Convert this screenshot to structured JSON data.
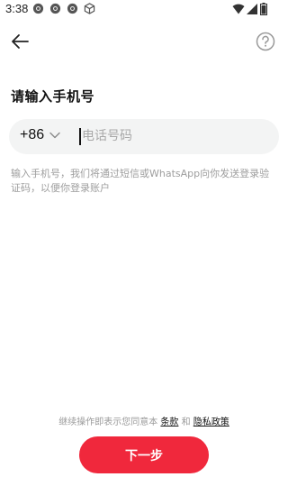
{
  "status_bar": {
    "time": "3:38",
    "icons": [
      "chrome-icon",
      "chrome-icon",
      "chrome-icon",
      "cube-icon",
      "wifi-icon",
      "signal-icon",
      "battery-icon"
    ]
  },
  "header": {
    "back_icon": "back-arrow-icon",
    "help_icon": "question-circle-icon"
  },
  "main": {
    "title": "请输入手机号",
    "country_code": "+86",
    "phone_placeholder": "电话号码",
    "phone_value": "",
    "hint": "输入手机号，我们将通过短信或WhatsApp向你发送登录验证码，以便你登录账户"
  },
  "footer": {
    "agreement_prefix": "继续操作即表示您同意本",
    "terms_link": "条款",
    "and": "和",
    "privacy_link": "隐私政策",
    "next_button": "下一步"
  },
  "colors": {
    "accent": "#f0283c",
    "input_bg": "#f3f4f4",
    "hint_text": "#9e9e9e"
  }
}
